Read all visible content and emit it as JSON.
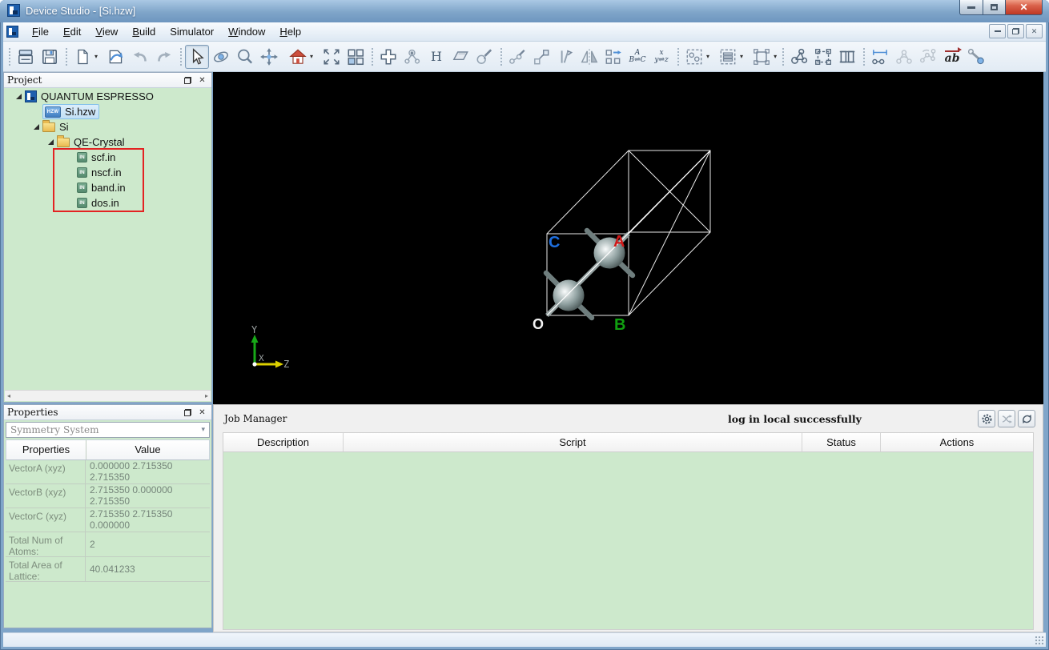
{
  "window": {
    "title": "Device Studio - [Si.hzw]"
  },
  "menu": {
    "items": [
      {
        "accel": "F",
        "rest": "ile"
      },
      {
        "accel": "E",
        "rest": "dit"
      },
      {
        "accel": "V",
        "rest": "iew"
      },
      {
        "accel": "B",
        "rest": "uild"
      },
      {
        "accel": "",
        "rest": "Simulator"
      },
      {
        "accel": "W",
        "rest": "indow"
      },
      {
        "accel": "H",
        "rest": "elp"
      }
    ]
  },
  "toolbar": {
    "hydrogen_label": "H",
    "ab_label": "ab",
    "swap_ac_top": "A",
    "swap_ac_bottom": "B⇌C",
    "swap_xyz_top": "x",
    "swap_xyz_bottom": "y⇌z",
    "icon_names": [
      "open",
      "save",
      "new-file",
      "export",
      "undo",
      "redo",
      "select-cursor",
      "rotate-view",
      "zoom-view",
      "pan-view",
      "home-view",
      "fit-view",
      "tile-windows",
      "add-atom",
      "add-fragment",
      "hydrogen",
      "eraser",
      "bond-pencil",
      "edit-bonds",
      "resize-box",
      "edit-vectors",
      "mirror",
      "swap-cells",
      "swap-abc",
      "swap-xyz",
      "select-atoms",
      "select-layers",
      "select-region",
      "build-cluster",
      "build-supercell",
      "build-lattice",
      "measure-distance",
      "measure-angle",
      "measure-torsion",
      "vector-label",
      "bond-ball"
    ]
  },
  "project": {
    "title": "Project",
    "items": [
      {
        "label": "QUANTUM ESPRESSO"
      },
      {
        "label": "Si.hzw",
        "badge": "HZW"
      },
      {
        "label": "Si"
      },
      {
        "label": "QE-Crystal"
      },
      {
        "label": "scf.in",
        "badge": "IN"
      },
      {
        "label": "nscf.in",
        "badge": "IN"
      },
      {
        "label": "band.in",
        "badge": "IN"
      },
      {
        "label": "dos.in",
        "badge": "IN"
      }
    ]
  },
  "properties": {
    "title": "Properties",
    "selector": "Symmetry System",
    "columns": [
      "Properties",
      "Value"
    ],
    "rows": [
      {
        "name": "VectorA (xyz)",
        "value": "0.000000 2.715350 2.715350"
      },
      {
        "name": "VectorB (xyz)",
        "value": "2.715350 0.000000 2.715350"
      },
      {
        "name": "VectorC (xyz)",
        "value": "2.715350 2.715350 0.000000"
      },
      {
        "name": "Total Num of Atoms:",
        "value": "2"
      },
      {
        "name": "Total Area of Lattice:",
        "value": "40.041233"
      }
    ]
  },
  "jobs": {
    "title": "Job Manager",
    "status_message": "log in local successfully",
    "columns": [
      "Description",
      "Script",
      "Status",
      "Actions"
    ]
  },
  "viewport": {
    "labels": {
      "a": "A",
      "b": "B",
      "c": "C",
      "origin": "O",
      "x": "X",
      "y": "Y",
      "z": "Z"
    },
    "colors": {
      "a": "#d01818",
      "b": "#10a010",
      "c": "#1e6ede",
      "background": "#000000",
      "atom": "#8fa0a0",
      "axis_y": "#18a818",
      "axis_z": "#ddd000"
    }
  }
}
